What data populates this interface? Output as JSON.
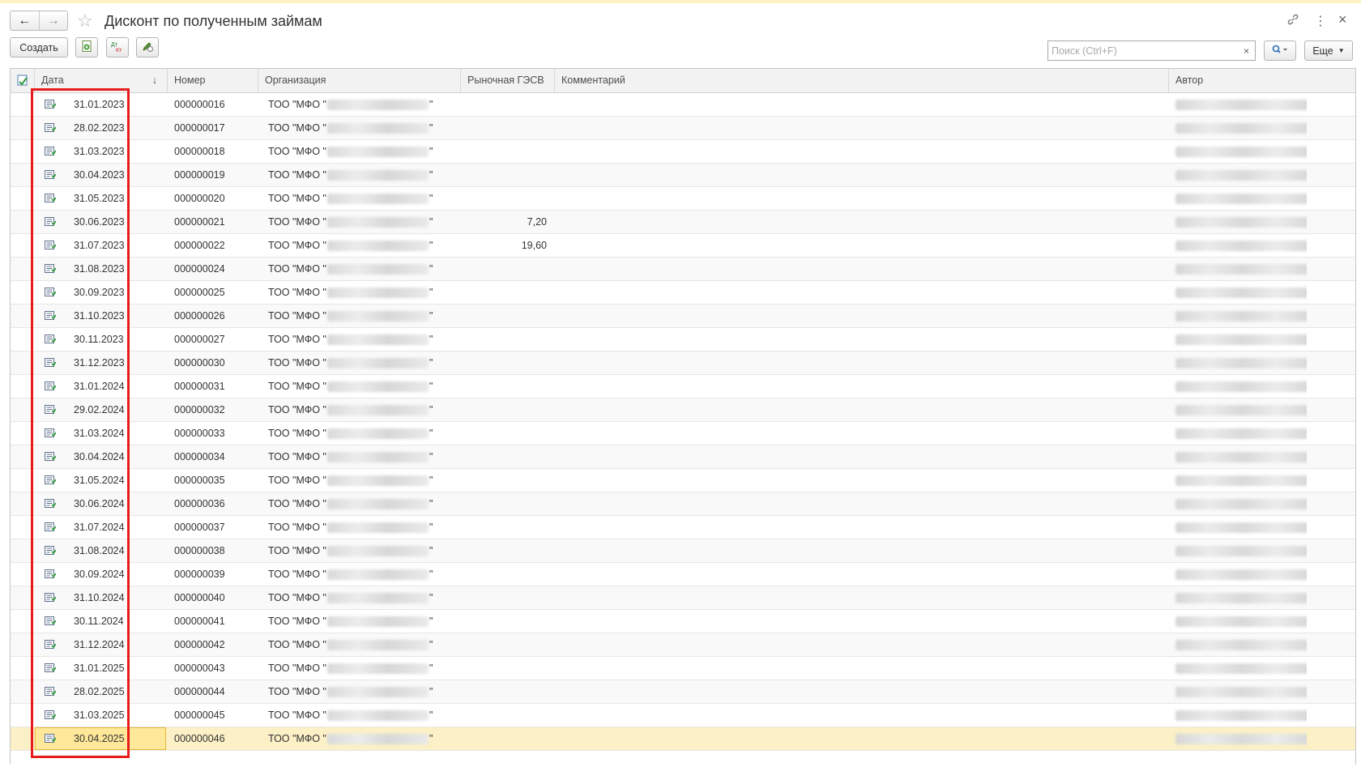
{
  "window": {
    "title": "Дисконт по полученным займам",
    "back_icon": "←",
    "forward_icon": "→",
    "favorite_icon": "☆",
    "link_icon": "🔗",
    "more_icon": "⋮",
    "close_icon": "×"
  },
  "toolbar": {
    "create_label": "Создать",
    "search_placeholder": "Поиск (Ctrl+F)",
    "search_clear": "×",
    "search_icon": "🔍",
    "more_label": "Еще"
  },
  "columns": {
    "date": "Дата",
    "number": "Номер",
    "organization": "Организация",
    "rate": "Рыночная ГЭСВ",
    "comment": "Комментарий",
    "author": "Автор",
    "sort_indicator": "↓"
  },
  "org_prefix": "ТОО \"МФО \"",
  "org_suffix": "\"",
  "rows": [
    {
      "date": "31.01.2023",
      "number": "000000016",
      "rate": ""
    },
    {
      "date": "28.02.2023",
      "number": "000000017",
      "rate": ""
    },
    {
      "date": "31.03.2023",
      "number": "000000018",
      "rate": ""
    },
    {
      "date": "30.04.2023",
      "number": "000000019",
      "rate": ""
    },
    {
      "date": "31.05.2023",
      "number": "000000020",
      "rate": ""
    },
    {
      "date": "30.06.2023",
      "number": "000000021",
      "rate": "7,20"
    },
    {
      "date": "31.07.2023",
      "number": "000000022",
      "rate": "19,60"
    },
    {
      "date": "31.08.2023",
      "number": "000000024",
      "rate": ""
    },
    {
      "date": "30.09.2023",
      "number": "000000025",
      "rate": ""
    },
    {
      "date": "31.10.2023",
      "number": "000000026",
      "rate": ""
    },
    {
      "date": "30.11.2023",
      "number": "000000027",
      "rate": ""
    },
    {
      "date": "31.12.2023",
      "number": "000000030",
      "rate": ""
    },
    {
      "date": "31.01.2024",
      "number": "000000031",
      "rate": ""
    },
    {
      "date": "29.02.2024",
      "number": "000000032",
      "rate": ""
    },
    {
      "date": "31.03.2024",
      "number": "000000033",
      "rate": ""
    },
    {
      "date": "30.04.2024",
      "number": "000000034",
      "rate": ""
    },
    {
      "date": "31.05.2024",
      "number": "000000035",
      "rate": ""
    },
    {
      "date": "30.06.2024",
      "number": "000000036",
      "rate": ""
    },
    {
      "date": "31.07.2024",
      "number": "000000037",
      "rate": ""
    },
    {
      "date": "31.08.2024",
      "number": "000000038",
      "rate": ""
    },
    {
      "date": "30.09.2024",
      "number": "000000039",
      "rate": ""
    },
    {
      "date": "31.10.2024",
      "number": "000000040",
      "rate": ""
    },
    {
      "date": "30.11.2024",
      "number": "000000041",
      "rate": ""
    },
    {
      "date": "31.12.2024",
      "number": "000000042",
      "rate": ""
    },
    {
      "date": "31.01.2025",
      "number": "000000043",
      "rate": ""
    },
    {
      "date": "28.02.2025",
      "number": "000000044",
      "rate": ""
    },
    {
      "date": "31.03.2025",
      "number": "000000045",
      "rate": ""
    },
    {
      "date": "30.04.2025",
      "number": "000000046",
      "rate": "",
      "selected": true
    }
  ],
  "colors": {
    "selected_row": "#fbf0c6",
    "highlight_frame": "#e81b1b",
    "header_bg": "#f2f2f2"
  }
}
